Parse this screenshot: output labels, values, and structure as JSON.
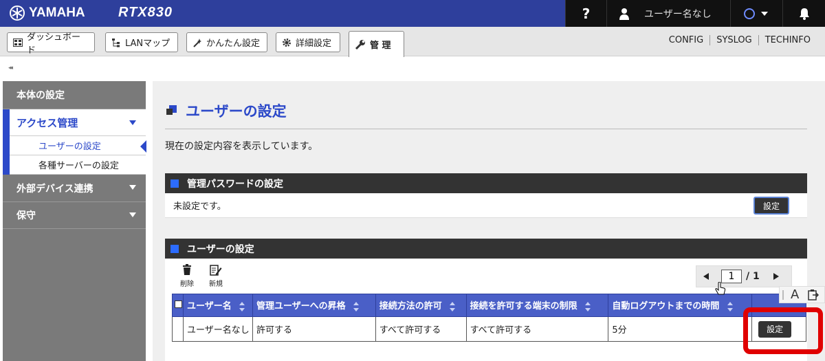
{
  "header": {
    "brand": "YAMAHA",
    "model": "RTX830",
    "help_label": "?",
    "user_label": "ユーザー名なし"
  },
  "tabs": [
    {
      "label": "ダッシュボード",
      "icon": "dashboard-icon"
    },
    {
      "label": "LANマップ",
      "icon": "lan-map-icon"
    },
    {
      "label": "かんたん設定",
      "icon": "wand-icon"
    },
    {
      "label": "詳細設定",
      "icon": "gear-icon"
    },
    {
      "label": "管 理",
      "icon": "wrench-icon",
      "active": true
    }
  ],
  "top_links": [
    "CONFIG",
    "SYSLOG",
    "TECHINFO"
  ],
  "collapse_label": "◂◂",
  "sidebar": {
    "body_settings": "本体の設定",
    "access_management": "アクセス管理",
    "access_items": [
      "ユーザーの設定",
      "各種サーバーの設定"
    ],
    "external_devices": "外部デバイス連携",
    "maintenance": "保守"
  },
  "main": {
    "title": "ユーザーの設定",
    "intro": "現在の設定内容を表示しています。",
    "admin_password": {
      "heading": "管理パスワードの設定",
      "status": "未設定です。",
      "button": "設定"
    },
    "users": {
      "heading": "ユーザーの設定",
      "delete_label": "削除",
      "new_label": "新規",
      "pager": {
        "current": "1",
        "total": "/ 1"
      },
      "columns": [
        "ユーザー名",
        "管理ユーザーへの昇格",
        "接続方法の許可",
        "接続を許可する端末の制限",
        "自動ログアウトまでの時間"
      ],
      "rows": [
        {
          "username": "ユーザー名なし",
          "admin": "許可する",
          "conn_method": "すべて許可する",
          "terminal": "すべて許可する",
          "logout": "5分",
          "button": "設定"
        }
      ]
    }
  },
  "float_tool": {
    "font_label": "A"
  },
  "colors": {
    "header_blue": "#2e3f9c",
    "accent_blue": "#2c49c9",
    "highlight_red": "#e00000"
  }
}
